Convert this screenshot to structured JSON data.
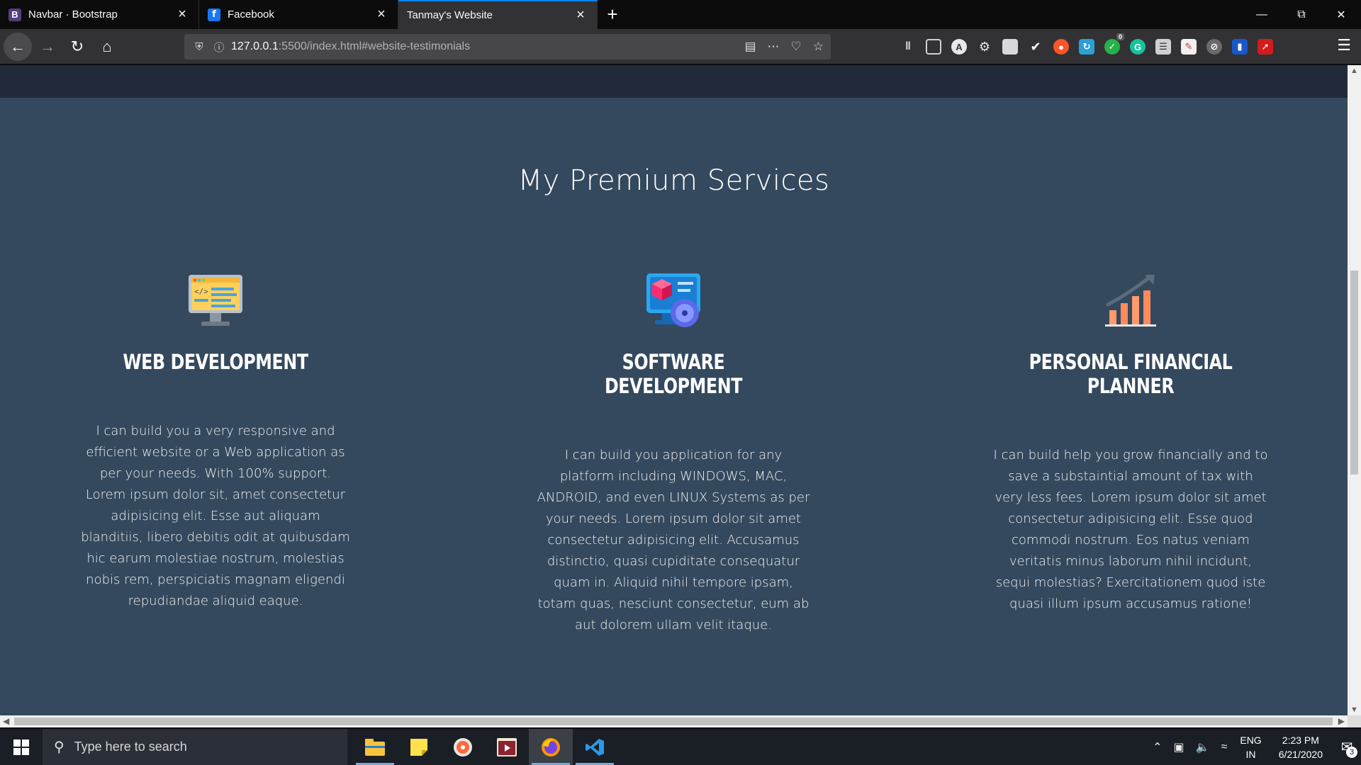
{
  "browser": {
    "tabs": [
      {
        "title": "Navbar · Bootstrap",
        "favicon": "B",
        "favicon_color": "#563d7c",
        "active": false
      },
      {
        "title": "Facebook",
        "favicon": "f",
        "favicon_color": "#1877f2",
        "active": false
      },
      {
        "title": "Tanmay's Website",
        "favicon": "",
        "favicon_color": "",
        "active": true
      }
    ],
    "url_host": "127.0.0.1",
    "url_path": ":5500/index.html#website-testimonials"
  },
  "page": {
    "section_title": "My Premium Services",
    "background_color": "#34495e",
    "services": [
      {
        "icon": "code-monitor-icon",
        "title": "WEB DEVELOPMENT",
        "description": "I can build you a very responsive and efficient website or a Web application as per your needs. With 100% support. Lorem ipsum dolor sit, amet consectetur adipisicing elit. Esse aut aliquam blanditiis, libero debitis odit at quibusdam hic earum molestiae nostrum, molestias nobis rem, perspiciatis magnam eligendi repudiandae aliquid eaque."
      },
      {
        "icon": "software-cube-icon",
        "title": "SOFTWARE DEVELOPMENT",
        "description": "I can build you application for any platform including WINDOWS, MAC, ANDROID, and even LINUX Systems as per your needs. Lorem ipsum dolor sit amet consectetur adipisicing elit. Accusamus distinctio, quasi cupiditate consequatur quam in. Aliquid nihil tempore ipsam, totam quas, nesciunt consectetur, eum ab aut dolorem ullam velit itaque."
      },
      {
        "icon": "growth-chart-icon",
        "title": "PERSONAL FINANCIAL PLANNER",
        "description": "I can build help you grow financially and to save a substaintial amount of tax with very less fees. Lorem ipsum dolor sit amet consectetur adipisicing elit. Esse quod commodi nostrum. Eos natus veniam veritatis minus laborum nihil incidunt, sequi molestias? Exercitationem quod iste quasi illum ipsum accusamus ratione!"
      }
    ]
  },
  "taskbar": {
    "search_placeholder": "Type here to search",
    "lang_line1": "ENG",
    "lang_line2": "IN",
    "time": "2:23 PM",
    "date": "6/21/2020",
    "notification_count": "3"
  },
  "extensions": {
    "badge_count": "0"
  }
}
